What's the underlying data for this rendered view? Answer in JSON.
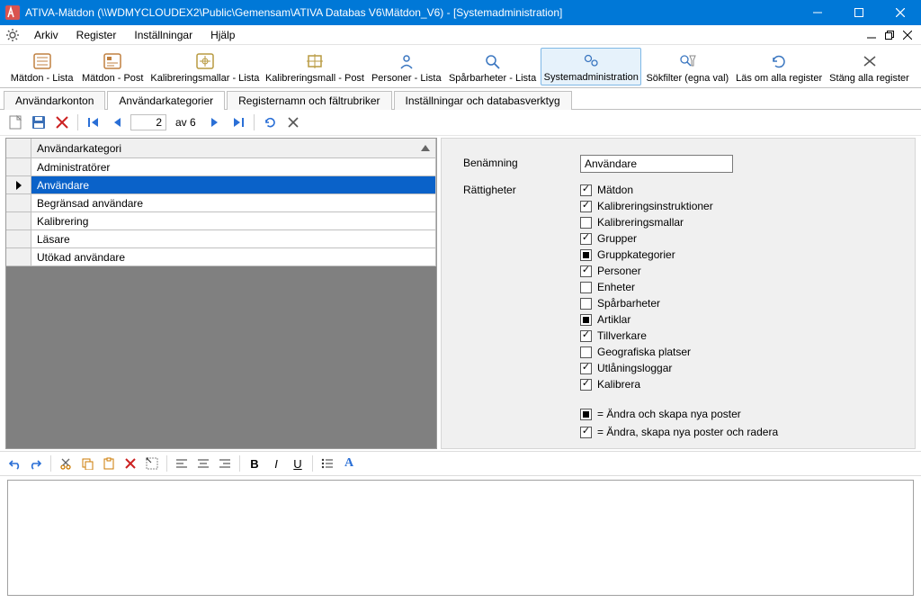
{
  "title": "ATIVA-Mätdon (\\\\WDMYCLOUDEX2\\Public\\Gemensam\\ATIVA Databas V6\\Mätdon_V6) - [Systemadministration]",
  "menu": {
    "arkiv": "Arkiv",
    "register": "Register",
    "installningar": "Inställningar",
    "hjalp": "Hjälp"
  },
  "toolbar": {
    "matdon_lista": "Mätdon - Lista",
    "matdon_post": "Mätdon - Post",
    "kalibreringsmallar_lista": "Kalibreringsmallar - Lista",
    "kalibreringsmall_post": "Kalibreringsmall - Post",
    "personer_lista": "Personer - Lista",
    "sparbarheter_lista": "Spårbarheter - Lista",
    "systemadmin": "Systemadministration",
    "sokfilter": "Sökfilter (egna val)",
    "las_om": "Läs om alla register",
    "stang_alla": "Stäng alla register"
  },
  "tabs": {
    "anvandarkonton": "Användarkonton",
    "anvandarkategorier": "Användarkategorier",
    "registernamn": "Registernamn och fältrubriker",
    "installningar": "Inställningar och databasverktyg"
  },
  "recordnav": {
    "current": "2",
    "of": "av 6"
  },
  "grid": {
    "header": "Användarkategori",
    "rows": [
      "Administratörer",
      "Användare",
      "Begränsad användare",
      "Kalibrering",
      "Läsare",
      "Utökad användare"
    ],
    "selected_index": 1
  },
  "form": {
    "benaming_label": "Benämning",
    "benaming_value": "Användare",
    "rattigheter_label": "Rättigheter",
    "rights": [
      {
        "label": "Mätdon",
        "state": "checked"
      },
      {
        "label": "Kalibreringsinstruktioner",
        "state": "checked"
      },
      {
        "label": "Kalibreringsmallar",
        "state": "unchecked"
      },
      {
        "label": "Grupper",
        "state": "checked"
      },
      {
        "label": "Gruppkategorier",
        "state": "indet"
      },
      {
        "label": "Personer",
        "state": "checked"
      },
      {
        "label": "Enheter",
        "state": "unchecked"
      },
      {
        "label": "Spårbarheter",
        "state": "unchecked"
      },
      {
        "label": "Artiklar",
        "state": "indet"
      },
      {
        "label": "Tillverkare",
        "state": "checked"
      },
      {
        "label": "Geografiska platser",
        "state": "unchecked"
      },
      {
        "label": "Utlåningsloggar",
        "state": "checked"
      },
      {
        "label": "Kalibrera",
        "state": "checked"
      }
    ],
    "legend_indet": "= Ändra och skapa nya poster",
    "legend_checked": "= Ändra, skapa nya poster och radera"
  }
}
